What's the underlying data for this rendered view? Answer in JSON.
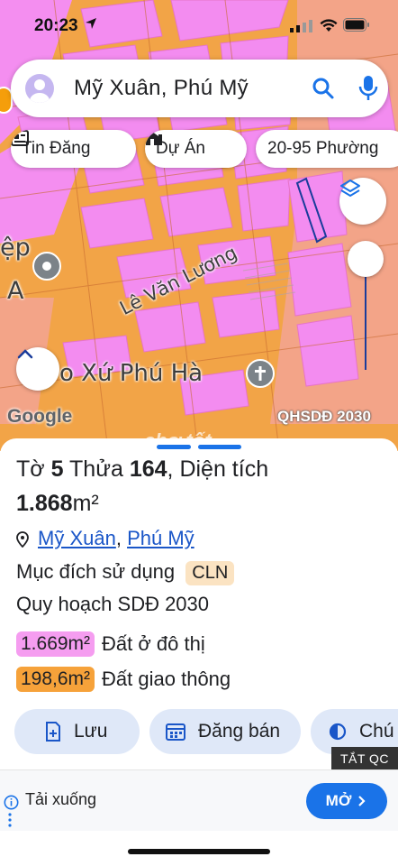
{
  "status_bar": {
    "time": "20:23"
  },
  "search": {
    "value": "Mỹ Xuân, Phú Mỹ"
  },
  "chips": [
    {
      "label": "Tin Đăng",
      "icon": "newspaper-icon"
    },
    {
      "label": "Dự Án",
      "icon": "building-icon"
    },
    {
      "label": "20-95 Phường"
    }
  ],
  "map": {
    "street_label": "Lê Văn Lương",
    "church_label": "o Xứ Phú Hà",
    "partial_label_1": "ệp",
    "partial_label_2": "A",
    "provider": "Google",
    "plan_layer": "QHSDĐ 2030",
    "watermark": "chợ tốt"
  },
  "parcel": {
    "sheet_label": "Tờ",
    "sheet_no": "5",
    "parcel_label": "Thửa",
    "parcel_no": "164",
    "area_label": "Diện tích",
    "area_value": "1.868",
    "area_unit": "m²",
    "ward": "Mỹ Xuân",
    "district": "Phú Mỹ",
    "purpose_label": "Mục đích sử dụng",
    "purpose_code": "CLN",
    "plan_label": "Quy hoạch SDĐ 2030",
    "zones": [
      {
        "area": "1.669m²",
        "name": "Đất ở đô thị",
        "color": "#f59df0"
      },
      {
        "area": "198,6m²",
        "name": "Đất giao thông",
        "color": "#f6a23a"
      }
    ]
  },
  "actions": [
    {
      "label": "Lưu",
      "icon": "bookmark-add-icon"
    },
    {
      "label": "Đăng bán",
      "icon": "calendar-icon"
    },
    {
      "label": "Chú",
      "icon": "half-circle-icon"
    }
  ],
  "ad": {
    "tag": "TẮT QC",
    "text": "Tải xuống",
    "button": "MỞ"
  },
  "colors": {
    "accent": "#1a73e8",
    "residential_pink": "#f59df0",
    "road_orange": "#f6a23a",
    "action_bg": "#dfe8f8"
  }
}
